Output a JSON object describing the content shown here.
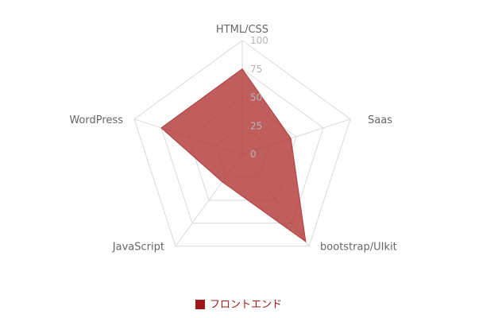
{
  "chart_data": {
    "type": "radar",
    "categories": [
      "HTML/CSS",
      "Saas",
      "bootstrap/UIkit",
      "JavaScript",
      "WordPress"
    ],
    "series": [
      {
        "name": "フロントエンド",
        "values": [
          75,
          45,
          95,
          30,
          75
        ]
      }
    ],
    "rlim": [
      0,
      100
    ],
    "ticks": [
      "0",
      "25",
      "50",
      "75",
      "100"
    ],
    "grid": true,
    "legend_position": "bottom",
    "colors": {
      "series_fill": "#b23b3b",
      "series_stroke": "#b23b3b",
      "legend_swatch": "#a01818",
      "grid": "#d9d9d9"
    }
  }
}
